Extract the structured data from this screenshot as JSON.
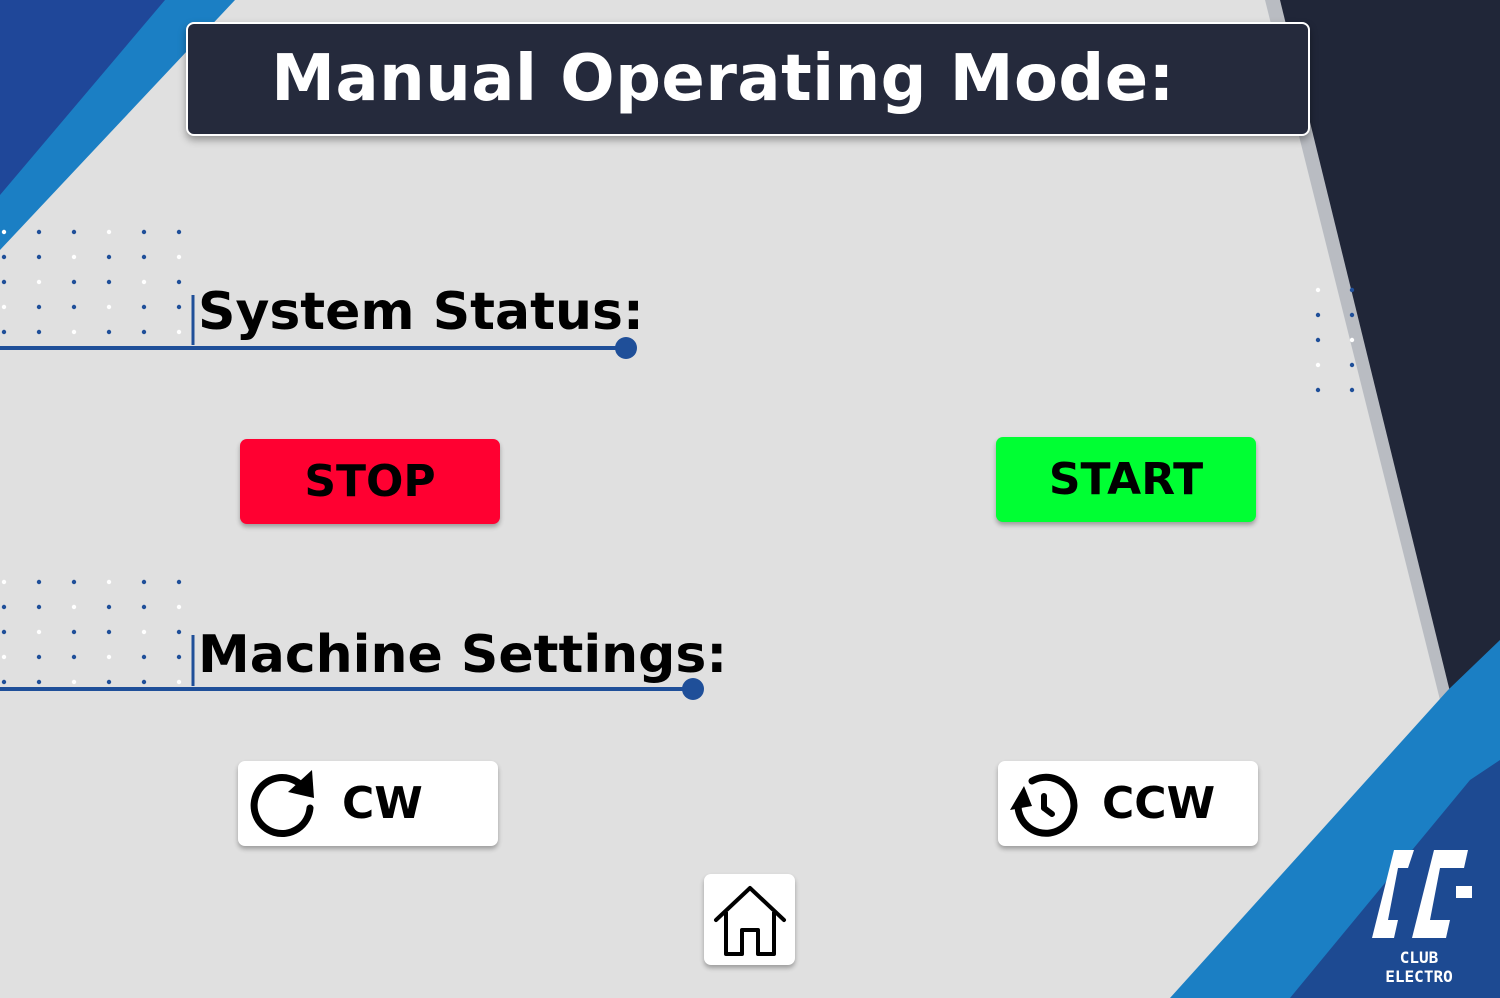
{
  "header": {
    "title": "Manual Operating Mode:"
  },
  "sections": {
    "system_status": {
      "heading": "System Status:"
    },
    "machine_settings": {
      "heading": "Machine Settings:"
    }
  },
  "buttons": {
    "stop": {
      "label": "STOP",
      "color": "#ff0031"
    },
    "start": {
      "label": "START",
      "color": "#00ff33"
    },
    "cw": {
      "label": "CW",
      "icon": "rotate-clockwise-icon"
    },
    "ccw": {
      "label": "CCW",
      "icon": "rotate-counterclockwise-icon"
    },
    "home": {
      "icon": "home-icon"
    }
  },
  "branding": {
    "logo_text": "CLUB ELECTRO"
  },
  "colors": {
    "background": "#e0e0e0",
    "title_bar": "#252a3c",
    "accent_blue": "#1f4f99",
    "accent_light_blue": "#1b7fc4",
    "dark_navy": "#202638"
  }
}
